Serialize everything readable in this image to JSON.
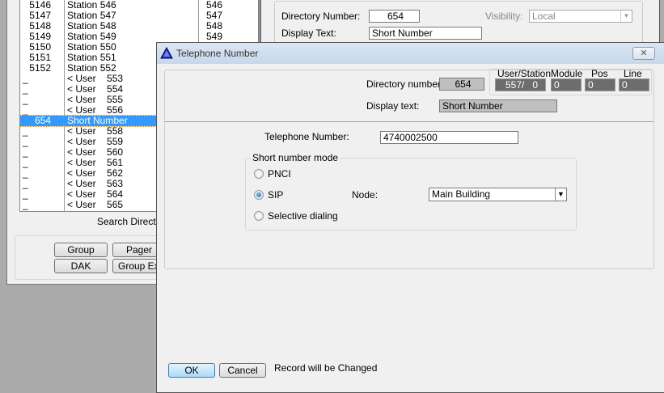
{
  "background_window": {
    "list_rows": [
      {
        "num": "5146",
        "name": "Station 546",
        "ext": "546"
      },
      {
        "num": "5147",
        "name": "Station 547",
        "ext": "547"
      },
      {
        "num": "5148",
        "name": "Station 548",
        "ext": "548"
      },
      {
        "num": "5149",
        "name": "Station 549",
        "ext": "549"
      },
      {
        "num": "5150",
        "name": "Station 550",
        "ext": ""
      },
      {
        "num": "5151",
        "name": "Station 551",
        "ext": ""
      },
      {
        "num": "5152",
        "name": "Station 552",
        "ext": ""
      },
      {
        "num": "_",
        "name": "< User    553",
        "ext": ""
      },
      {
        "num": "_",
        "name": "< User    554",
        "ext": ""
      },
      {
        "num": "_",
        "name": "< User    555",
        "ext": ""
      },
      {
        "num": "_",
        "name": "< User    556",
        "ext": ""
      },
      {
        "num": "654",
        "name": "Short Number",
        "ext": "",
        "selected": true
      },
      {
        "num": "_",
        "name": "< User    558",
        "ext": ""
      },
      {
        "num": "_",
        "name": "< User    559",
        "ext": ""
      },
      {
        "num": "_",
        "name": "< User    560",
        "ext": ""
      },
      {
        "num": "_",
        "name": "< User    561",
        "ext": ""
      },
      {
        "num": "_",
        "name": "< User    562",
        "ext": ""
      },
      {
        "num": "_",
        "name": "< User    563",
        "ext": ""
      },
      {
        "num": "_",
        "name": "< User    564",
        "ext": ""
      },
      {
        "num": "_",
        "name": "< User    565",
        "ext": ""
      }
    ],
    "search_label": "Search Directo",
    "buttons": {
      "group": "Group",
      "pager": "Pager",
      "dak": "DAK",
      "group_ext": "Group Ex"
    },
    "detail": {
      "dir_label": "Directory Number:",
      "dir_value": "654",
      "visibility_label": "Visibility:",
      "visibility_value": "Local",
      "display_label": "Display Text:",
      "display_value": "Short Number"
    }
  },
  "dialog": {
    "title": "Telephone Number",
    "dir_label": "Directory number:",
    "dir_value": "654",
    "display_label": "Display text:",
    "display_value": "Short Number",
    "location": {
      "headers": [
        "User/Station",
        "Module",
        "Pos",
        "Line"
      ],
      "values": [
        "557/   0",
        "0",
        "0",
        "0"
      ]
    },
    "tel_label": "Telephone Number:",
    "tel_value": "4740002500",
    "mode_group": "Short number mode",
    "modes": [
      {
        "label": "PNCI",
        "selected": false
      },
      {
        "label": "SIP",
        "selected": true
      },
      {
        "label": "Selective dialing",
        "selected": false
      }
    ],
    "node_label": "Node:",
    "node_value": "Main Building",
    "ok": "OK",
    "cancel": "Cancel",
    "status": "Record will be Changed"
  }
}
